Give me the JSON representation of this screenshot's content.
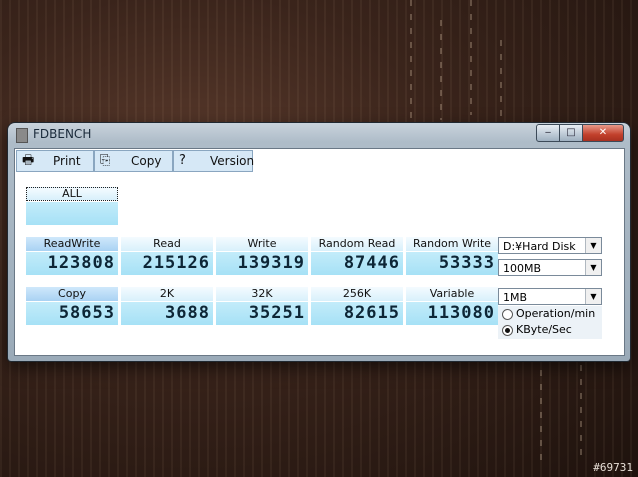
{
  "window": {
    "title": "FDBENCH",
    "buttons": {
      "minimize": "‒",
      "maximize": "□",
      "close": "✕"
    }
  },
  "toolbar": {
    "print_label": "Print",
    "copy_label": "Copy",
    "version_label": "Version"
  },
  "all_button": {
    "label": "ALL",
    "value": ""
  },
  "row1": [
    {
      "label": "ReadWrite",
      "value": "123808"
    },
    {
      "label": "Read",
      "value": "215126"
    },
    {
      "label": "Write",
      "value": "139319"
    },
    {
      "label": "Random Read",
      "value": "87446"
    },
    {
      "label": "Random Write",
      "value": "53333"
    }
  ],
  "row2": [
    {
      "label": "Copy",
      "value": "58653"
    },
    {
      "label": "2K",
      "value": "3688"
    },
    {
      "label": "32K",
      "value": "35251"
    },
    {
      "label": "256K",
      "value": "82615"
    },
    {
      "label": "Variable",
      "value": "113080"
    }
  ],
  "options": {
    "drive": "D:¥Hard Disk",
    "test_size": "100MB",
    "block_size": "1MB",
    "unit_options": [
      "Operation/min",
      "KByte/Sec"
    ],
    "unit_selected": "KByte/Sec"
  },
  "watermark": "#69731",
  "colors": {
    "tile_value_bg": "#a6e1f6",
    "tile_header_bg": "#d8f0fb",
    "close_red": "#c2402c"
  }
}
